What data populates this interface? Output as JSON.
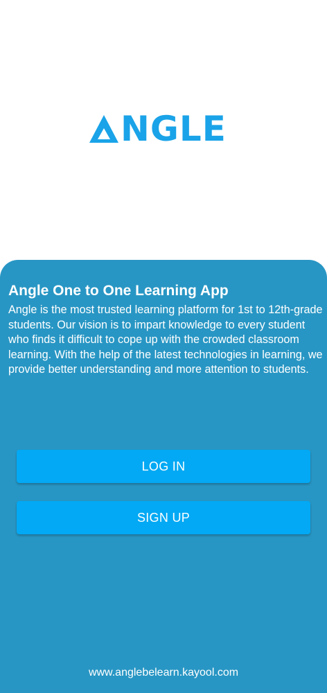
{
  "brand": {
    "logo_text": "NGLE",
    "logo_color": "#1aa3e8"
  },
  "intro": {
    "title": "Angle One to One Learning App",
    "description": "Angle is the most trusted learning platform for 1st to 12th-grade students. Our vision is to impart knowledge to every student who finds it difficult to cope up with the crowded classroom learning. With the help of the latest technologies in learning, we provide better understanding and more attention to students."
  },
  "actions": {
    "login_label": "LOG IN",
    "signup_label": "SIGN UP"
  },
  "footer": {
    "website": "www.anglebelearn.kayool.com"
  },
  "colors": {
    "panel": "#2896c4",
    "button": "#03a9f4"
  }
}
